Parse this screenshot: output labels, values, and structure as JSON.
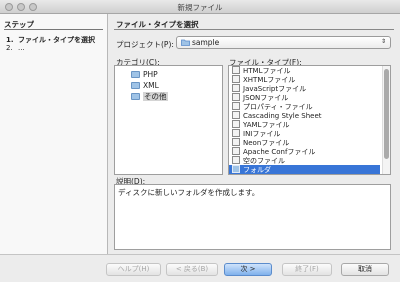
{
  "window": {
    "title": "新規ファイル"
  },
  "steps": {
    "header": "ステップ",
    "items": [
      {
        "num": "1.",
        "label": "ファイル・タイプを選択"
      },
      {
        "num": "2.",
        "label": "..."
      }
    ]
  },
  "main": {
    "header": "ファイル・タイプを選択",
    "project_label": "プロジェクト(P):",
    "project_value": "sample",
    "categories_label": "カテゴリ(C):",
    "categories": [
      "PHP",
      "XML",
      "その他"
    ],
    "selected_category": "その他",
    "file_types_label": "ファイル・タイプ(F):",
    "file_types": [
      "HTMLファイル",
      "XHTMLファイル",
      "JavaScriptファイル",
      "JSONファイル",
      "プロパティ・ファイル",
      "Cascading Style Sheet",
      "YAMLファイル",
      "INIファイル",
      "Neonファイル",
      "Apache Confファイル",
      "空のファイル",
      "フォルダ"
    ],
    "selected_file_type": "フォルダ",
    "description_label": "説明(D):",
    "description_text": "ディスクに新しいフォルダを作成します。"
  },
  "buttons": {
    "help": "ヘルプ(H)",
    "back": "< 戻る(B)",
    "next": "次 >",
    "finish": "終了(F)",
    "cancel": "取消"
  }
}
